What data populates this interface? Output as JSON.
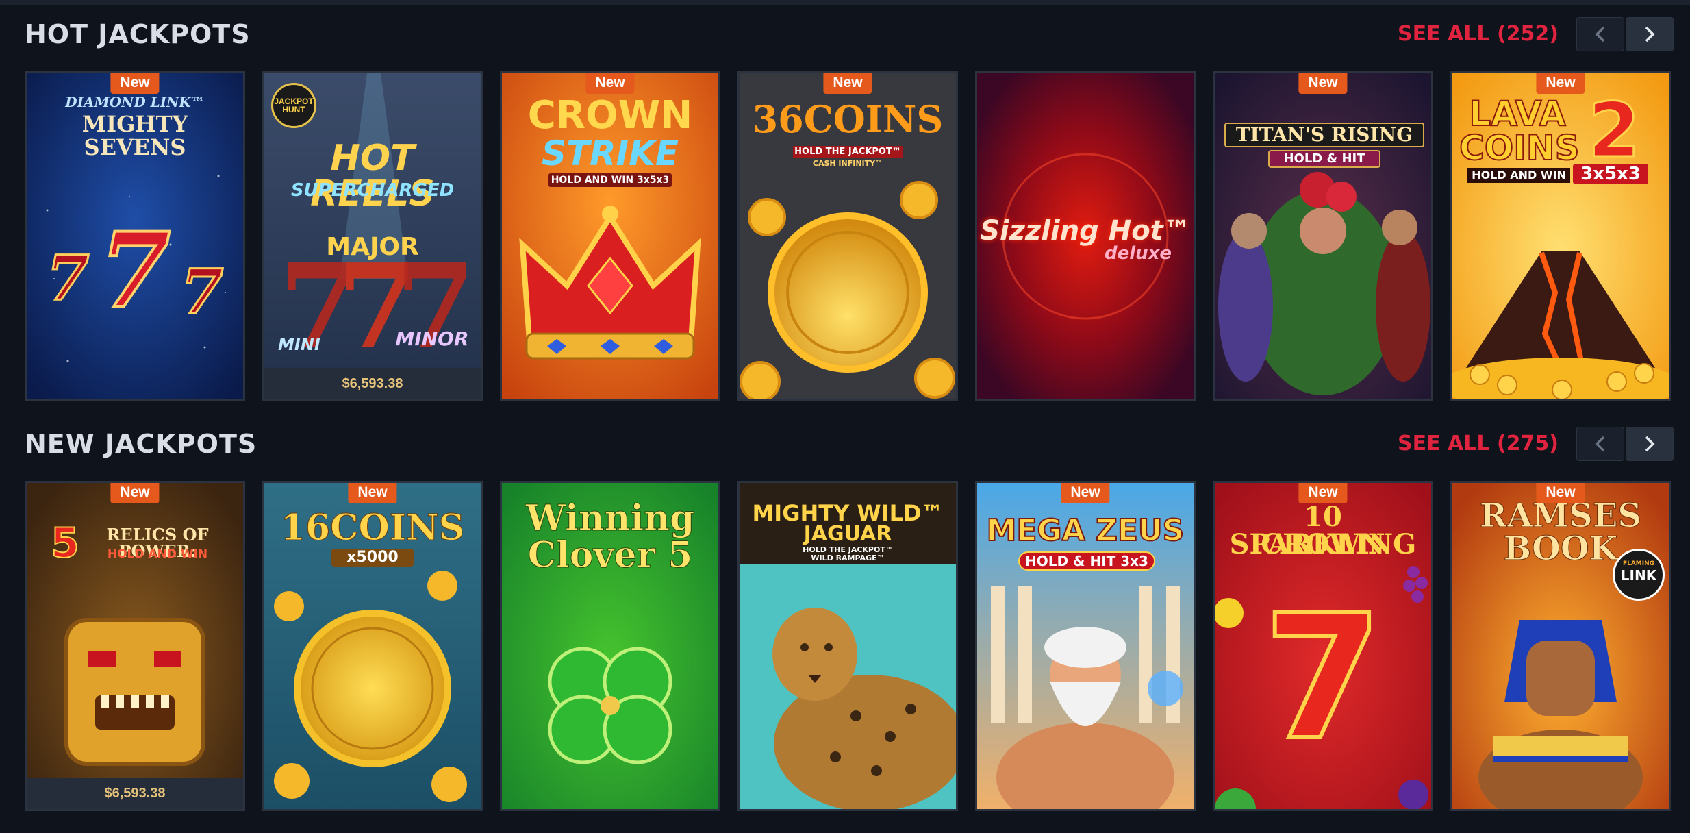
{
  "hot": {
    "title": "HOT JACKPOTS",
    "see_all": "SEE ALL (252)",
    "games": [
      {
        "id": "mighty-sevens",
        "l1": "DIAMOND LINK™",
        "l2": "MIGHTY",
        "l3": "SEVENS",
        "new": "New"
      },
      {
        "id": "hot-reels",
        "logo": "JACKPOT HUNT",
        "l1": "HOT REELS",
        "l2": "SUPERCHARGED",
        "tag1": "MAJOR",
        "tag2": "MINI",
        "tag3": "MINOR",
        "jackpot": "$6,593.38"
      },
      {
        "id": "crown-strike",
        "l1": "CROWN",
        "l2": "STRIKE",
        "l3": "HOLD AND WIN 3x5x3",
        "new": "New"
      },
      {
        "id": "36-coins",
        "l1": "36COINS",
        "l2": "HOLD THE JACKPOT™",
        "l3": "CASH INFINITY™",
        "new": "New"
      },
      {
        "id": "sizzling-hot",
        "l1": "Sizzling Hot™",
        "l2": "deluxe"
      },
      {
        "id": "titans-rising",
        "l1": "TITAN'S RISING",
        "l2": "HOLD & HIT",
        "new": "New"
      },
      {
        "id": "lava-coins-2",
        "l1": "LAVA",
        "l2": "COINS",
        "l3": "2",
        "l4": "HOLD AND WIN",
        "l5": "3x5x3",
        "new": "New"
      }
    ]
  },
  "newjp": {
    "title": "NEW JACKPOTS",
    "see_all": "SEE ALL (275)",
    "games": [
      {
        "id": "relics-of-power",
        "l1": "5",
        "l2": "RELICS OF POWER:",
        "l3": "HOLD AND WIN",
        "new": "New",
        "jackpot": "$6,593.38"
      },
      {
        "id": "16-coins",
        "l1": "16COINS",
        "l2": "x5000",
        "new": "New"
      },
      {
        "id": "winning-clover-5",
        "l1": "Winning",
        "l2": "Clover 5"
      },
      {
        "id": "mighty-wild-jaguar",
        "l1": "MIGHTY WILD™",
        "l2": "JAGUAR",
        "l3": "HOLD THE JACKPOT™",
        "l4": "WILD RAMPAGE™"
      },
      {
        "id": "mega-zeus",
        "l1": "MEGA ZEUS",
        "l2": "HOLD & HIT 3x3",
        "new": "New"
      },
      {
        "id": "10-sparkling-crown",
        "l1": "10 SPARKLING",
        "l2": "CROWN",
        "l3": "7",
        "new": "New"
      },
      {
        "id": "ramses-book",
        "l1": "RAMSES",
        "l2": "BOOK",
        "l3": "FLAMING",
        "l4": "LINK",
        "new": "New"
      }
    ]
  },
  "colors": {
    "background": "#0f131b",
    "see_all": "#e0243f",
    "new_badge": "#e55a1c",
    "jackpot_text": "#e5c27a"
  },
  "icons": {
    "prev": "chevron-left-icon",
    "next": "chevron-right-icon"
  }
}
